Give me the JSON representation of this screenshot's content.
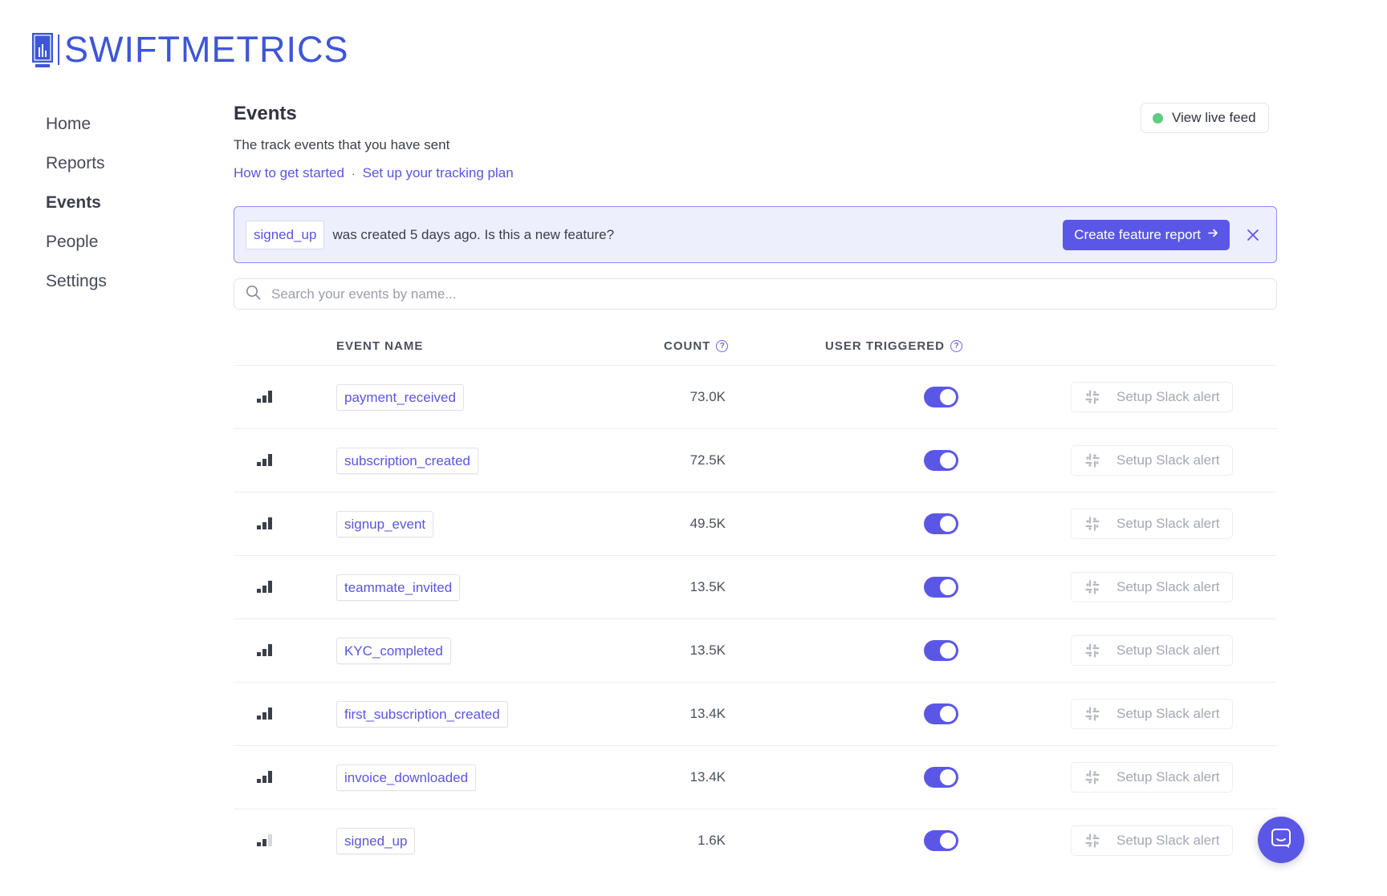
{
  "app": {
    "name": "SWIFTMETRICS",
    "accent": "#5b57e6",
    "brand": "#3f55d8"
  },
  "sidebar": {
    "items": [
      {
        "label": "Home",
        "active": false
      },
      {
        "label": "Reports",
        "active": false
      },
      {
        "label": "Events",
        "active": true
      },
      {
        "label": "People",
        "active": false
      },
      {
        "label": "Settings",
        "active": false
      }
    ]
  },
  "page": {
    "title": "Events",
    "subtitle": "The track events that you have sent",
    "links": [
      "How to get started",
      "Set up your tracking plan"
    ],
    "link_separator": "·",
    "live_feed_label": "View live feed",
    "live_status_color": "#5fcc7f"
  },
  "banner": {
    "event_tag": "signed_up",
    "message": "was created 5 days ago. Is this a new feature?",
    "cta_label": "Create feature report",
    "cta_icon": "arrow-right-icon",
    "close_icon": "close-icon"
  },
  "search": {
    "placeholder": "Search your events by name...",
    "value": "",
    "icon": "search-icon"
  },
  "table": {
    "columns": {
      "event_name": "EVENT NAME",
      "count": "COUNT",
      "user_triggered": "USER TRIGGERED",
      "help_icon": "?"
    },
    "rows": [
      {
        "name": "payment_received",
        "count": "73.0K",
        "user_triggered": true,
        "level": 3,
        "action": "Setup Slack alert"
      },
      {
        "name": "subscription_created",
        "count": "72.5K",
        "user_triggered": true,
        "level": 3,
        "action": "Setup Slack alert"
      },
      {
        "name": "signup_event",
        "count": "49.5K",
        "user_triggered": true,
        "level": 3,
        "action": "Setup Slack alert"
      },
      {
        "name": "teammate_invited",
        "count": "13.5K",
        "user_triggered": true,
        "level": 3,
        "action": "Setup Slack alert"
      },
      {
        "name": "KYC_completed",
        "count": "13.5K",
        "user_triggered": true,
        "level": 3,
        "action": "Setup Slack alert"
      },
      {
        "name": "first_subscription_created",
        "count": "13.4K",
        "user_triggered": true,
        "level": 3,
        "action": "Setup Slack alert"
      },
      {
        "name": "invoice_downloaded",
        "count": "13.4K",
        "user_triggered": true,
        "level": 3,
        "action": "Setup Slack alert"
      },
      {
        "name": "signed_up",
        "count": "1.6K",
        "user_triggered": true,
        "level": 2,
        "action": "Setup Slack alert"
      }
    ]
  },
  "chat_widget": {
    "icon": "chat-icon"
  }
}
